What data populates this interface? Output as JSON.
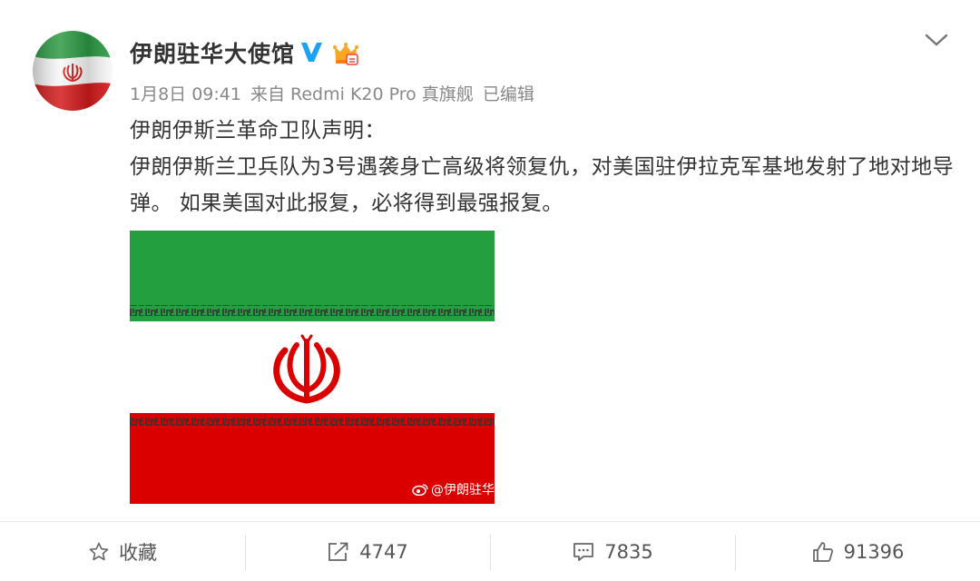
{
  "post": {
    "user_name": "伊朗驻华大使馆",
    "date": "1月8日 09:41",
    "source": "来自 Redmi K20 Pro 真旗舰",
    "edited": "已编辑",
    "text_lines": [
      "伊朗伊斯兰革命卫队声明：",
      "伊朗伊斯兰卫兵队为3号遇袭身亡高级将领复仇，对美国驻伊拉克军基地发射了地对地导弹。 如果美国对此报复，必将得到最强报复。"
    ],
    "image": {
      "watermark": "@伊朗驻华"
    }
  },
  "icons": {
    "verified": "verified-v-icon",
    "member": "crown-member-icon",
    "dropdown": "chevron-down-icon",
    "favorite": "star-icon",
    "repost": "repost-icon",
    "comment": "comment-icon",
    "like": "thumbs-up-icon"
  },
  "actions": {
    "favorite_label": "收藏",
    "repost_count": "4747",
    "comment_count": "7835",
    "like_count": "91396"
  },
  "colors": {
    "green": "#239f40",
    "red": "#da0000",
    "verified_blue": "#1da1f2",
    "meta_gray": "#888888",
    "text": "#333333"
  }
}
